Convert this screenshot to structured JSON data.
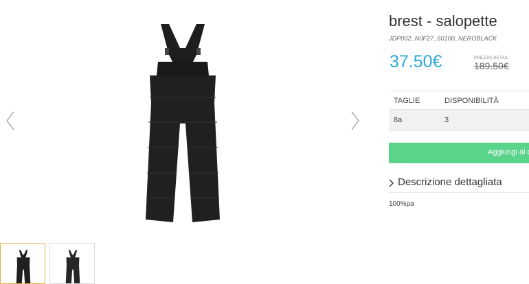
{
  "product": {
    "title": "brest - salopette",
    "sku": "JDP002_N0F27_60100_NEROBLACK",
    "price": "37.50€",
    "retail_label": "PREZZO RETAIL",
    "retail_price": "189.50€",
    "price_color": "#2aa8d8"
  },
  "sizes": {
    "headers": [
      "TAGLIE",
      "DISPONIBILITÀ"
    ],
    "rows": [
      {
        "size": "8a",
        "availability": "3"
      }
    ]
  },
  "cart": {
    "add_label": "Aggiungi al carrello",
    "button_color": "#5ad38b"
  },
  "description": {
    "toggle_label": "Descrizione dettagliata",
    "text": "100%pa"
  },
  "gallery": {
    "main_image": "black-ski-salopette",
    "thumbnails": [
      "salopette-front",
      "salopette-back"
    ],
    "selected_thumbnail": 0,
    "selected_border_color": "#e6b04a"
  }
}
